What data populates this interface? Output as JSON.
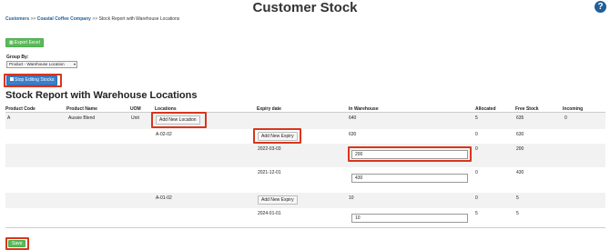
{
  "page": {
    "title": "Customer Stock",
    "help_icon": "?"
  },
  "breadcrumb": {
    "items": [
      "Customers",
      "Coastal Coffee Company"
    ],
    "separator": ">>",
    "current": "Stock Report with Warehouse Locations"
  },
  "toolbar": {
    "export_label": "Export Excel",
    "export_icon": "table-icon"
  },
  "groupby": {
    "label": "Group By:",
    "selected": "Product - Warehouse Location"
  },
  "edit": {
    "stop_label": "Stop Editing Stocks"
  },
  "report": {
    "title": "Stock Report with Warehouse Locations",
    "columns": [
      "Product Code",
      "Product Name",
      "UOM",
      "Locations",
      "Expiry date",
      "In Warehouse",
      "Allocated",
      "Free Stock",
      "Incoming"
    ],
    "product": {
      "code": "A",
      "name": "Aussie Blend",
      "uom": "Unit",
      "in_warehouse": "640",
      "allocated": "5",
      "free_stock": "635",
      "incoming": "0",
      "add_location_label": "Add New Location"
    },
    "locations": [
      {
        "name": "A-02-02",
        "in_warehouse": "630",
        "allocated": "0",
        "free_stock": "630",
        "add_expiry_label": "Add New Expiry",
        "expiries": [
          {
            "date": "2022-03-03",
            "qty": "200",
            "allocated": "0",
            "free_stock": "200"
          },
          {
            "date": "2021-12-01",
            "qty": "430",
            "allocated": "0",
            "free_stock": "430"
          }
        ]
      },
      {
        "name": "A-01-02",
        "in_warehouse": "10",
        "allocated": "0",
        "free_stock": "5",
        "add_expiry_label": "Add New Expiry",
        "expiries": [
          {
            "date": "2024-01-01",
            "qty": "10",
            "allocated": "5",
            "free_stock": "5"
          }
        ]
      }
    ]
  },
  "footer": {
    "save_label": "Save"
  },
  "colors": {
    "primary": "#3c7ec8",
    "success": "#5cb85c",
    "highlight": "#d9361c",
    "link": "#1f5f9a"
  }
}
